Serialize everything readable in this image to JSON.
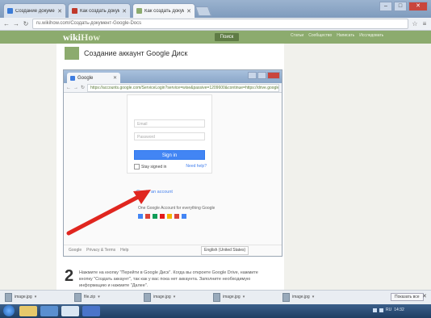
{
  "browser": {
    "tabs": [
      {
        "label": "Создание документа",
        "active": false
      },
      {
        "label": "Как создать документ",
        "active": false
      },
      {
        "label": "Как создать документ",
        "active": true
      }
    ],
    "url": "ru.wikihow.com/Создать-документ-Google-Docs",
    "window_controls": {
      "minimize": "–",
      "maximize": "□",
      "close": "✕"
    }
  },
  "wikihow": {
    "logo_wiki": "wiki",
    "logo_how": "How",
    "search_button": "Поиск",
    "nav": [
      "Статьи",
      "Сообщество",
      "Написать",
      "Исследовать"
    ],
    "article_title": "Создание аккаунт Google Диск"
  },
  "inner_browser": {
    "tab_label": "Google",
    "url": "https://accounts.google.com/ServiceLogin?service=wise&passive=1209600&continue=https://drive.google.com",
    "email_placeholder": "Email",
    "password_placeholder": "Password",
    "sign_in": "Sign in",
    "stay_signed_in": "Stay signed in",
    "need_help": "Need help?",
    "create_account": "Create an account",
    "one_account": "One Google Account for everything Google",
    "footer_links": [
      "Google",
      "Privacy & Terms",
      "Help"
    ],
    "language": "English (United States)"
  },
  "step2": {
    "number": "2",
    "text": "Нажмите на кнопку \"Перейти в Google Диск\". Когда вы откроете Google Drive, нажмите кнопку \"Создать аккаунт\", так как у вас пока нет аккаунта. Заполните необходимую информацию и нажмите \"Далее\"."
  },
  "downloads": {
    "items": [
      "image.jpg",
      "file.zip",
      "image.jpg",
      "image.jpg",
      "image.jpg"
    ],
    "show_all": "Показать все",
    "close": "✕"
  },
  "taskbar": {
    "apps": [
      "start",
      "explorer",
      "media",
      "chrome",
      "word"
    ],
    "lang": "RU",
    "time": "14:32"
  },
  "colors": {
    "wikihow_green": "#8cab6e",
    "google_blue": "#4285f4",
    "arrow_red": "#e0261f"
  }
}
